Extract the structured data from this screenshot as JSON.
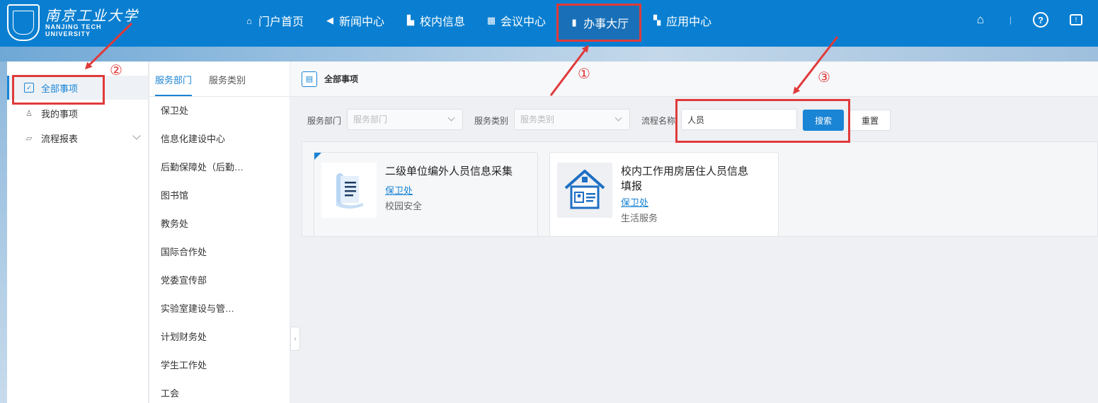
{
  "header": {
    "logo": {
      "cn": "南京工业大学",
      "en_line1": "NANJING TECH",
      "en_line2": "UNIVERSITY"
    },
    "nav": [
      {
        "label": "门户首页",
        "icon": "home-outline-icon"
      },
      {
        "label": "新闻中心",
        "icon": "speaker-icon"
      },
      {
        "label": "校内信息",
        "icon": "building-icon"
      },
      {
        "label": "会议中心",
        "icon": "table-icon"
      },
      {
        "label": "办事大厅",
        "icon": "bag-icon",
        "active": true
      },
      {
        "label": "应用中心",
        "icon": "grid-icon"
      }
    ],
    "right_icons": [
      "home-icon",
      "help-icon",
      "message-icon"
    ]
  },
  "left_menu": [
    {
      "label": "全部事项",
      "icon": "checkbox-icon",
      "active": true
    },
    {
      "label": "我的事项",
      "icon": "user-icon"
    },
    {
      "label": "流程报表",
      "icon": "chart-icon",
      "expandable": true
    }
  ],
  "dept_panel": {
    "tabs": [
      {
        "label": "服务部门",
        "active": true
      },
      {
        "label": "服务类别"
      }
    ],
    "items": [
      "保卫处",
      "信息化建设中心",
      "后勤保障处（后勤…",
      "图书馆",
      "教务处",
      "国际合作处",
      "党委宣传部",
      "实验室建设与管…",
      "计划财务处",
      "学生工作处",
      "工会"
    ]
  },
  "main": {
    "breadcrumb": "全部事项",
    "filter": {
      "dept_label": "服务部门",
      "dept_placeholder": "服务部门",
      "category_label": "服务类别",
      "category_placeholder": "服务类别",
      "name_label": "流程名称",
      "name_value": "人员",
      "search_label": "搜索",
      "reset_label": "重置"
    },
    "cards": [
      {
        "title": "二级单位编外人员信息采集",
        "dept": "保卫处",
        "category": "校园安全",
        "icon": "document-scroll-icon"
      },
      {
        "title_line1": "校内工作用房居住人员信息",
        "title_line2": "填报",
        "dept": "保卫处",
        "category": "生活服务",
        "icon": "house-id-card-icon"
      }
    ]
  },
  "annotations": [
    "①",
    "②",
    "③"
  ],
  "colors": {
    "primary": "#0a7fd1",
    "accent": "#1a84d5",
    "annotation": "#e03a3a"
  }
}
